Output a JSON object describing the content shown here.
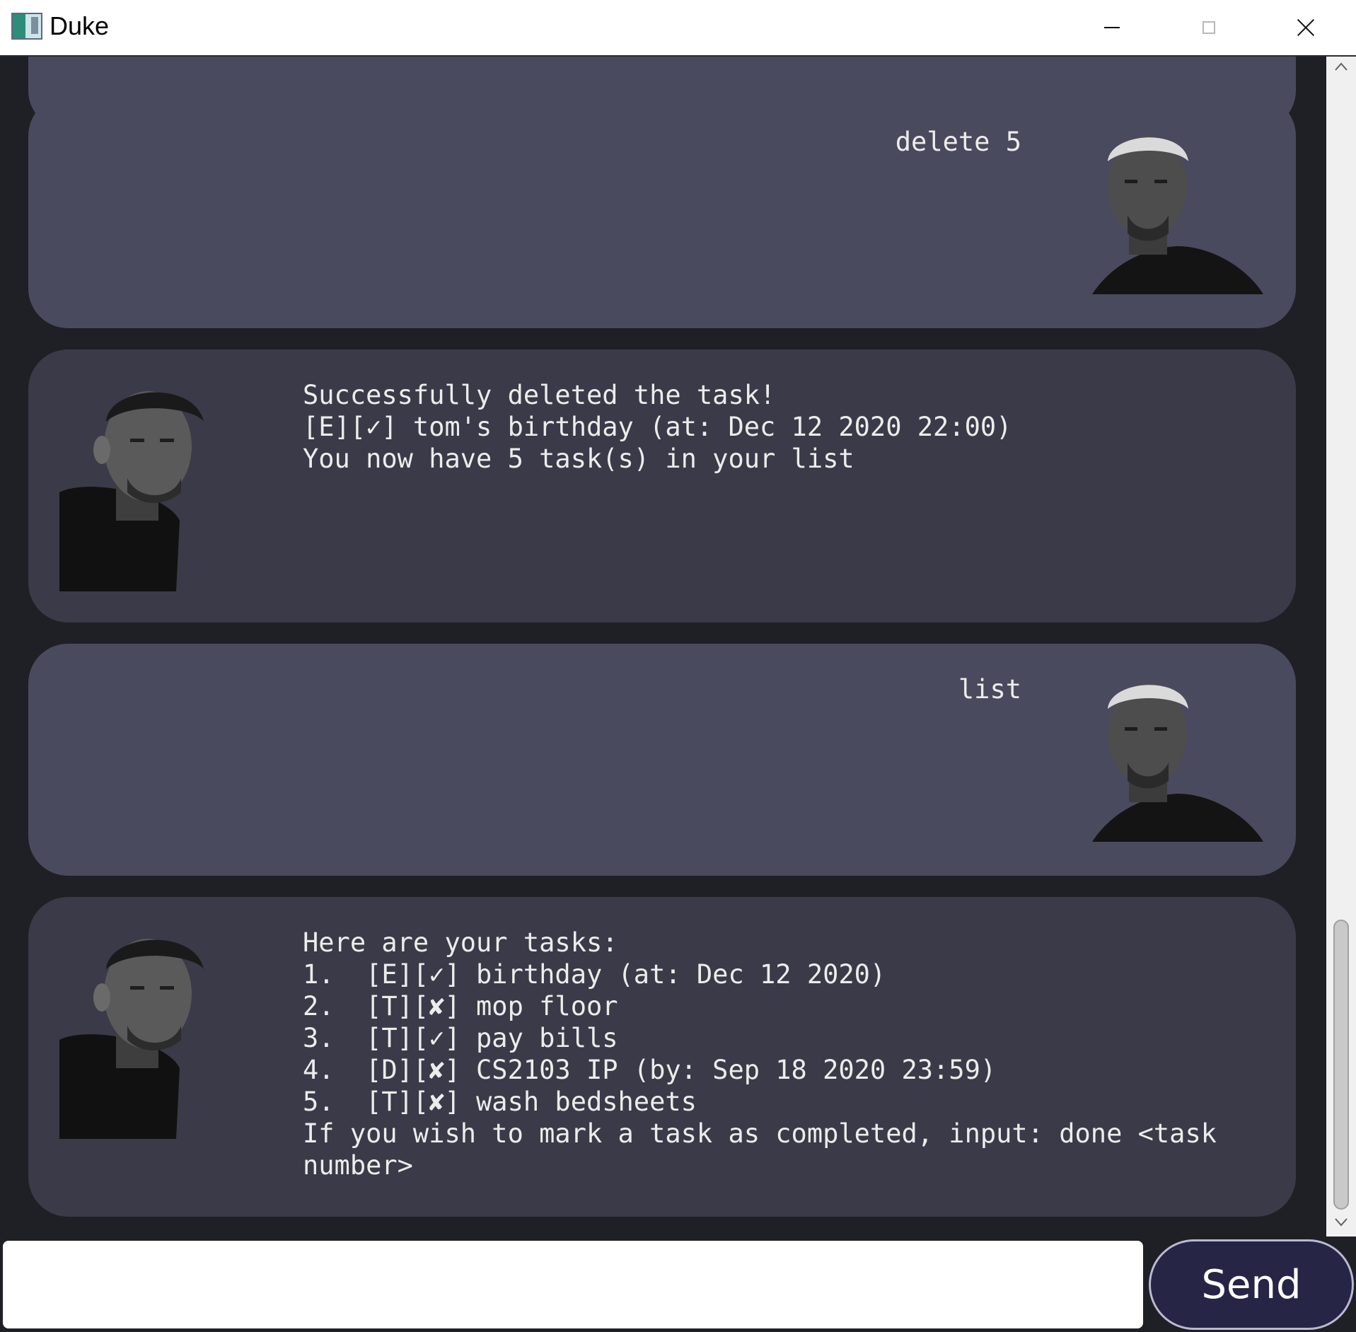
{
  "window": {
    "title": "Duke",
    "controls": {
      "minimize_icon": "minimize-icon",
      "maximize_icon": "maximize-icon",
      "close_icon": "close-icon"
    }
  },
  "colors": {
    "background": "#1f1f26",
    "user_bubble": "#4a4a5e",
    "bot_bubble": "#3a3a48",
    "text": "#ececec",
    "send_button": "#262545"
  },
  "messages": [
    {
      "sender": "user",
      "text": ""
    },
    {
      "sender": "user",
      "text": "delete 5",
      "avatar": "kanye-avatar"
    },
    {
      "sender": "duke",
      "text": "Successfully deleted the task!\n[E][✓] tom's birthday (at: Dec 12 2020 22:00)\nYou now have 5 task(s) in your list",
      "avatar": "drake-avatar"
    },
    {
      "sender": "user",
      "text": "list",
      "avatar": "kanye-avatar"
    },
    {
      "sender": "duke",
      "text": "Here are your tasks:\n1.  [E][✓] birthday (at: Dec 12 2020)\n2.  [T][✘] mop floor\n3.  [T][✓] pay bills\n4.  [D][✘] CS2103 IP (by: Sep 18 2020 23:59)\n5.  [T][✘] wash bedsheets\nIf you wish to mark a task as completed, input: done <task number>",
      "avatar": "drake-avatar"
    }
  ],
  "input": {
    "value": "",
    "placeholder": ""
  },
  "send_button": {
    "label": "Send"
  }
}
